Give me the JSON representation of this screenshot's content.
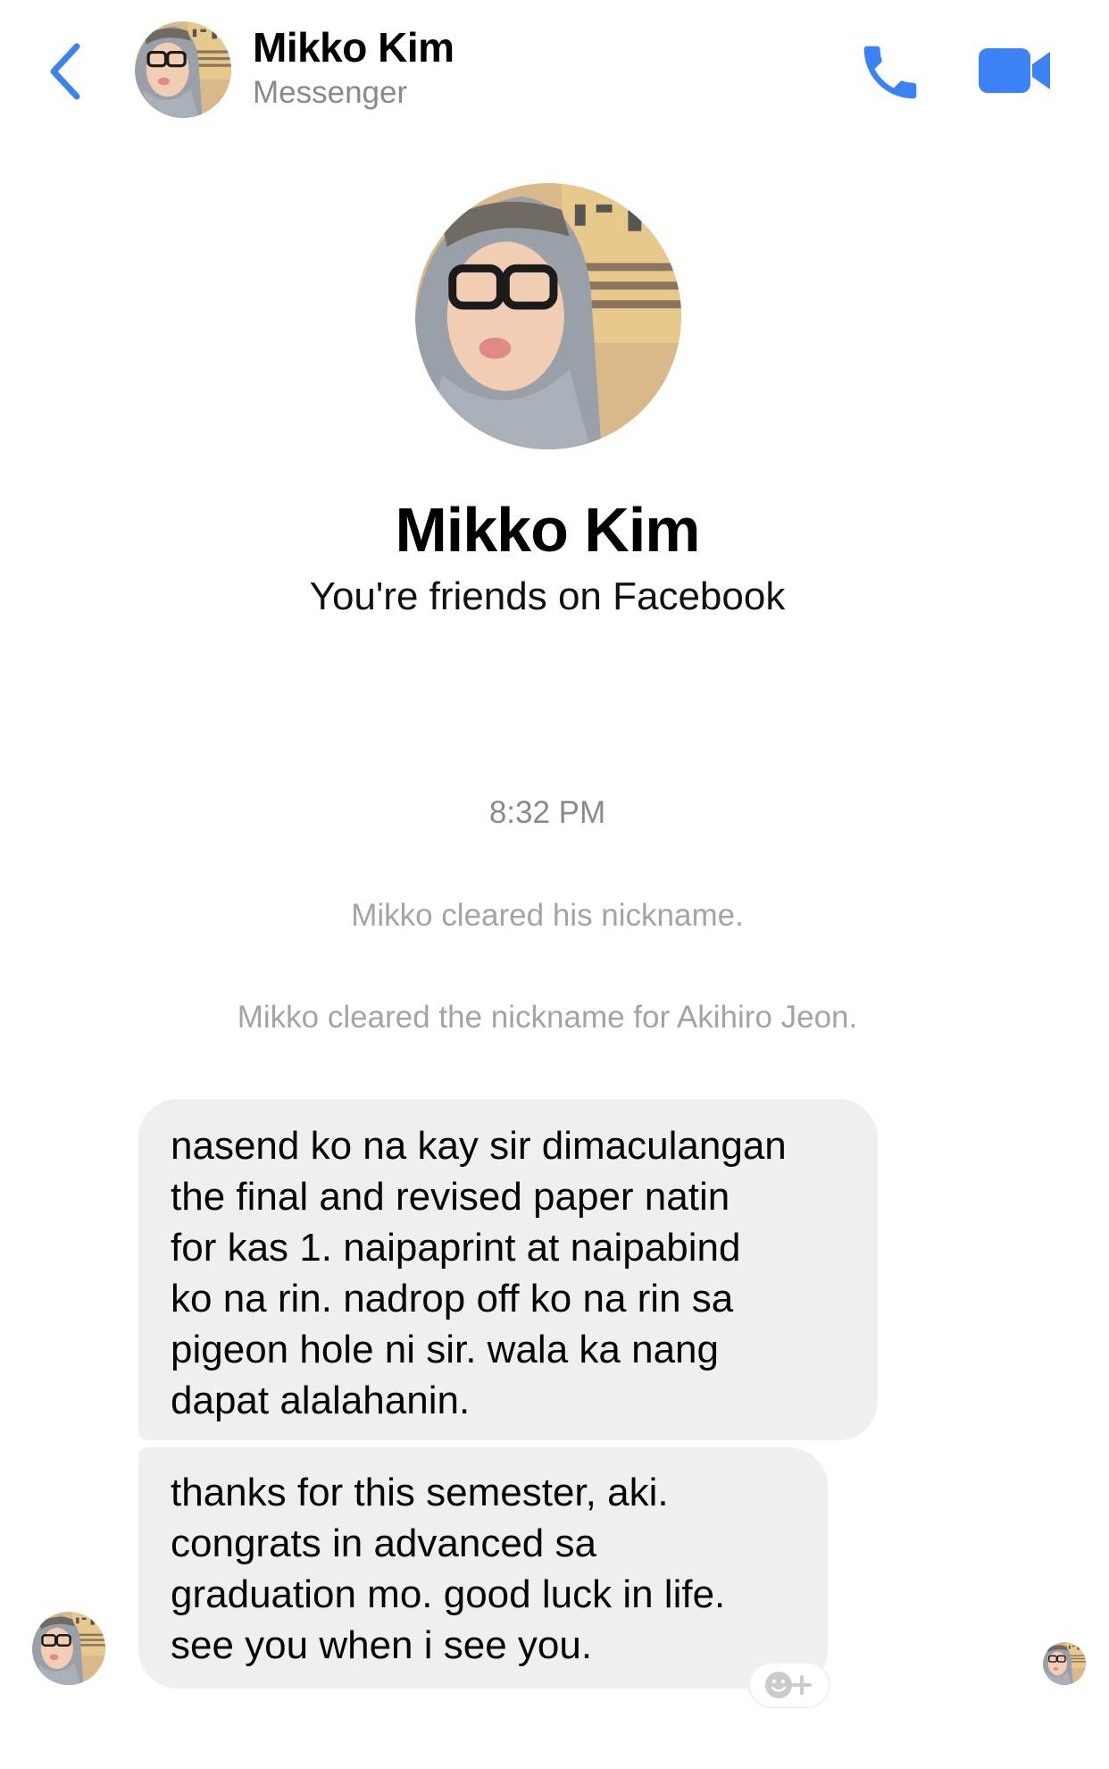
{
  "header": {
    "contact_name": "Mikko Kim",
    "subtitle": "Messenger",
    "icons": {
      "back": "back-chevron-icon",
      "call": "phone-icon",
      "video": "video-camera-icon"
    }
  },
  "profile": {
    "name": "Mikko Kim",
    "relation": "You're friends on Facebook"
  },
  "thread": {
    "timestamp": "8:32 PM",
    "system_messages": [
      "Mikko cleared his nickname.",
      "Mikko cleared the nickname for Akihiro Jeon."
    ],
    "messages": [
      {
        "text": "nasend ko na kay sir dimaculangan\nthe final and revised paper natin\nfor kas 1. naipaprint at naipabind\nko na rin. nadrop off ko na rin sa\npigeon hole ni sir. wala ka nang\ndapat alalahanin."
      },
      {
        "text": "thanks for this semester, aki.\ncongrats in advanced sa\ngraduation mo. good luck in life.\nsee you when i see you."
      }
    ]
  },
  "colors": {
    "accent": "#3b82f6",
    "bubble_bg": "#efefef",
    "muted_text": "#8a8a8e"
  }
}
